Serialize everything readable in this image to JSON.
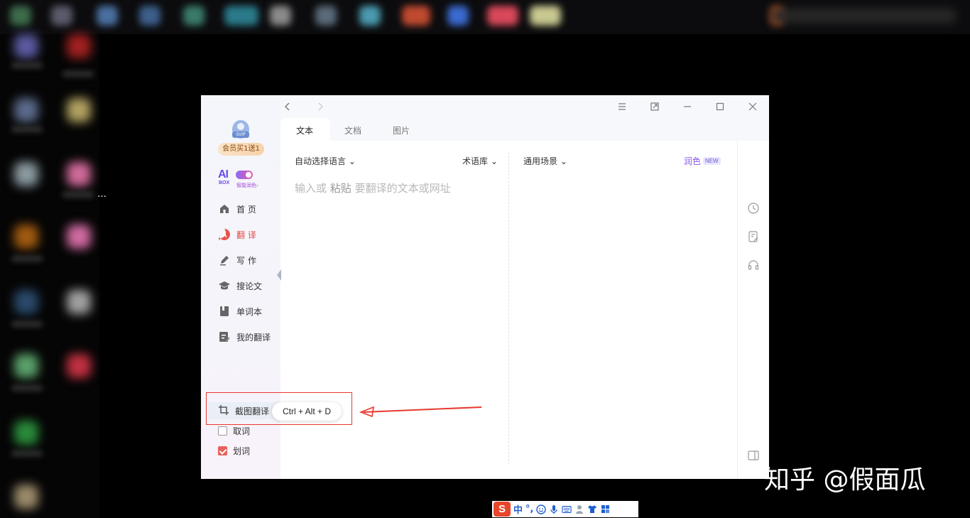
{
  "colors": {
    "accent_red": "#e24a46",
    "accent_purple": "#8a55e8",
    "annotation_red": "#e53a30"
  },
  "sidebar": {
    "avatar_badge": "SVIP",
    "promo": "会员买1送1",
    "aibox": {
      "logo_ai": "AI",
      "logo_box": "BOX",
      "subtitle": "智能润色"
    },
    "nav": [
      {
        "label": "首 页",
        "icon": "home-icon"
      },
      {
        "label": "翻 译",
        "icon": "translate-icon",
        "active": true
      },
      {
        "label": "写 作",
        "icon": "pen-icon"
      },
      {
        "label": "搜论文",
        "icon": "graduation-cap-icon"
      },
      {
        "label": "单词本",
        "icon": "book-icon"
      },
      {
        "label": "我的翻译",
        "icon": "document-icon"
      }
    ],
    "bottom": [
      {
        "label": "截图翻译",
        "icon": "crop-icon"
      },
      {
        "label": "取词",
        "checked": false
      },
      {
        "label": "划词",
        "checked": true
      }
    ],
    "shortcut": "Ctrl + Alt + D"
  },
  "tabs": [
    {
      "label": "文本",
      "active": true
    },
    {
      "label": "文档"
    },
    {
      "label": "图片"
    }
  ],
  "content": {
    "source_lang": "自动选择语言",
    "glossary": "术语库",
    "scene": "通用场景",
    "polish": "润色",
    "new_badge": "NEW",
    "placeholder_1": "输入或",
    "placeholder_2": "粘贴",
    "placeholder_3": "要翻译的文本或网址"
  },
  "ime": {
    "logo": "S",
    "mode": "中",
    "punct": "°,"
  },
  "watermark": "知乎 @假面瓜"
}
